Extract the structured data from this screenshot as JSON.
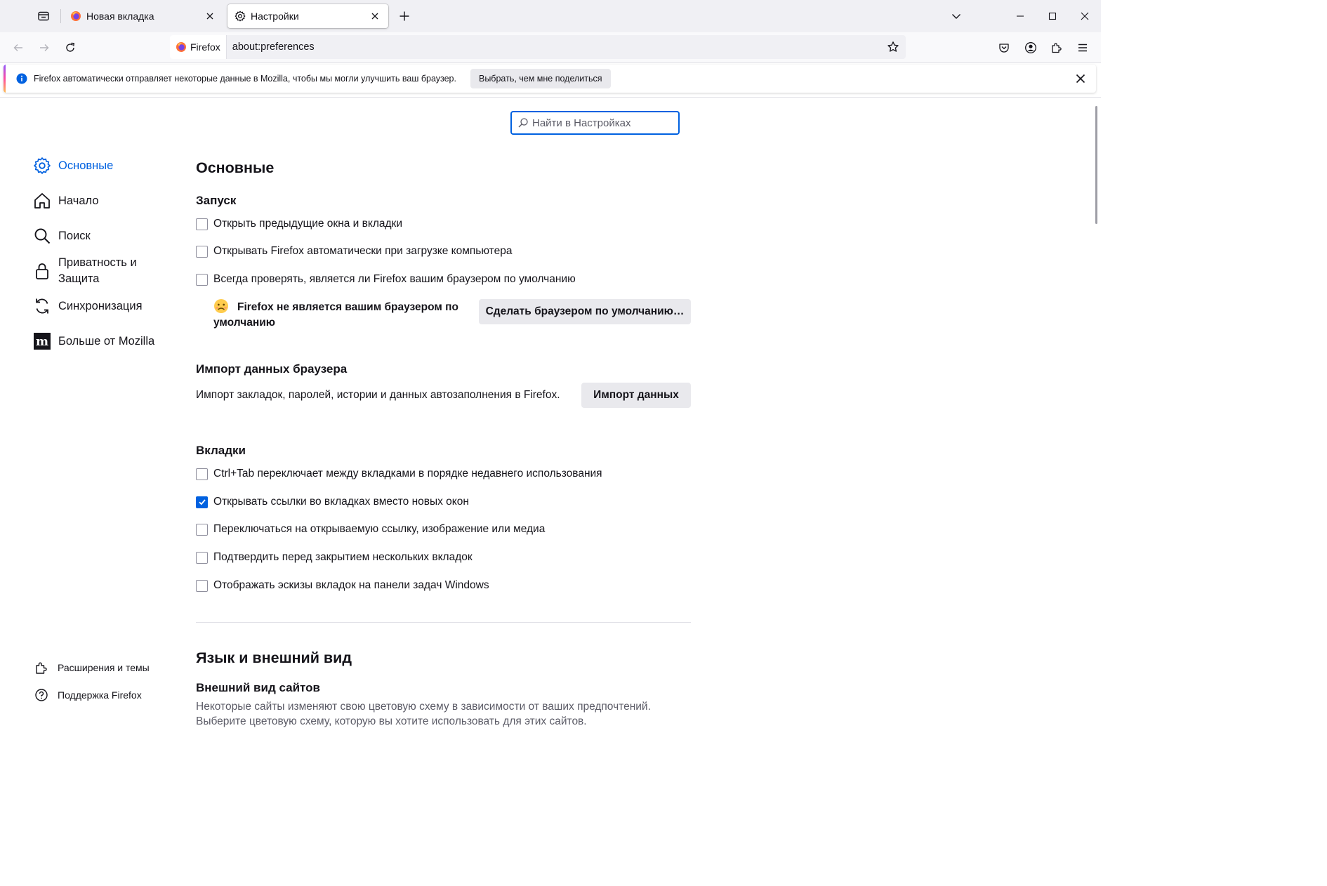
{
  "tabs": [
    {
      "title": "Новая вкладка",
      "active": false
    },
    {
      "title": "Настройки",
      "active": true
    }
  ],
  "urlbar": {
    "identity_label": "Firefox",
    "url": "about:preferences"
  },
  "notification": {
    "message": "Firefox автоматически отправляет некоторые данные в Mozilla, чтобы мы могли улучшить ваш браузер.",
    "action_label": "Выбрать, чем мне поделиться"
  },
  "search": {
    "placeholder": "Найти в Настройках"
  },
  "sidebar": {
    "categories": [
      {
        "label": "Основные",
        "icon": "gear-icon",
        "selected": true
      },
      {
        "label": "Начало",
        "icon": "home-icon",
        "selected": false
      },
      {
        "label": "Поиск",
        "icon": "search-icon",
        "selected": false
      },
      {
        "label_line1": "Приватность и",
        "label_line2": "Защита",
        "icon": "lock-icon",
        "selected": false
      },
      {
        "label": "Синхронизация",
        "icon": "sync-icon",
        "selected": false
      },
      {
        "label": "Больше от Mozilla",
        "icon": "mozilla-icon",
        "selected": false
      }
    ],
    "footer": [
      {
        "label": "Расширения и темы",
        "icon": "extensions-icon"
      },
      {
        "label": "Поддержка Firefox",
        "icon": "help-icon"
      }
    ]
  },
  "main": {
    "page_title": "Основные",
    "startup": {
      "heading": "Запуск",
      "options": [
        {
          "label": "Открыть предыдущие окна и вкладки",
          "checked": false
        },
        {
          "label": "Открывать Firefox автоматически при загрузке компьютера",
          "checked": false
        },
        {
          "label": "Всегда проверять, является ли Firefox вашим браузером по умолчанию",
          "checked": false
        }
      ],
      "not_default_line1": "Firefox не является вашим браузером по",
      "not_default_line2": "умолчанию",
      "make_default_button": "Сделать браузером по умолчанию…"
    },
    "import": {
      "heading": "Импорт данных браузера",
      "description": "Импорт закладок, паролей, истории и данных автозаполнения в Firefox.",
      "button": "Импорт данных"
    },
    "tabs_section": {
      "heading": "Вкладки",
      "options": [
        {
          "label": "Ctrl+Tab переключает между вкладками в порядке недавнего использования",
          "checked": false
        },
        {
          "label": "Открывать ссылки во вкладках вместо новых окон",
          "checked": true
        },
        {
          "label": "Переключаться на открываемую ссылку, изображение или медиа",
          "checked": false
        },
        {
          "label": "Подтвердить перед закрытием нескольких вкладок",
          "checked": false
        },
        {
          "label": "Отображать эскизы вкладок на панели задач Windows",
          "checked": false
        }
      ]
    },
    "language_section": {
      "heading": "Язык и внешний вид",
      "subheading": "Внешний вид сайтов",
      "description_line1": "Некоторые сайты изменяют свою цветовую схему в зависимости от ваших предпочтений.",
      "description_line2": "Выберите цветовую схему, которую вы хотите использовать для этих сайтов."
    }
  },
  "colors": {
    "accent": "#0061e0",
    "tabstrip": "#f0f0f4",
    "button": "#e9e9ed"
  }
}
